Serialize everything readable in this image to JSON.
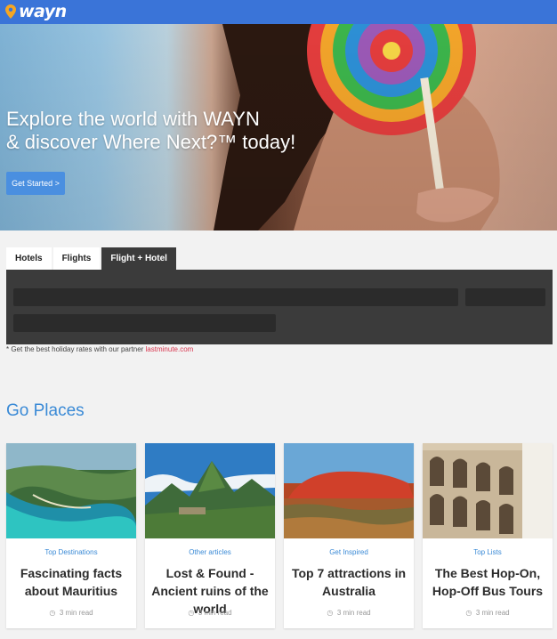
{
  "header": {
    "logo_text": "wayn",
    "brand_color": "#3a74d8"
  },
  "hero": {
    "title_line1": "Explore the world with WAYN",
    "title_line2": "& discover Where Next?™ today!",
    "cta_label": "Get Started >"
  },
  "booking": {
    "tabs": [
      "Hotels",
      "Flights",
      "Flight + Hotel"
    ],
    "active_tab": "Flight + Hotel",
    "note_prefix": "* Get the best holiday rates with our partner ",
    "partner_link": "lastminute.com"
  },
  "section": {
    "title": "Go Places"
  },
  "cards": [
    {
      "category": "Top Destinations",
      "title": "Fascinating facts about Mauritius",
      "read_time": "3 min read",
      "image": "mauritius-coast-image"
    },
    {
      "category": "Other articles",
      "title": "Lost & Found - Ancient ruins of the world",
      "read_time": "3 min read",
      "image": "mountain-ruins-image"
    },
    {
      "category": "Get Inspired",
      "title": "Top 7 attractions in Australia",
      "read_time": "3 min read",
      "image": "uluru-rock-image"
    },
    {
      "category": "Top Lists",
      "title": "The Best Hop-On, Hop-Off Bus Tours",
      "read_time": "3 min read",
      "image": "colosseum-image"
    }
  ]
}
